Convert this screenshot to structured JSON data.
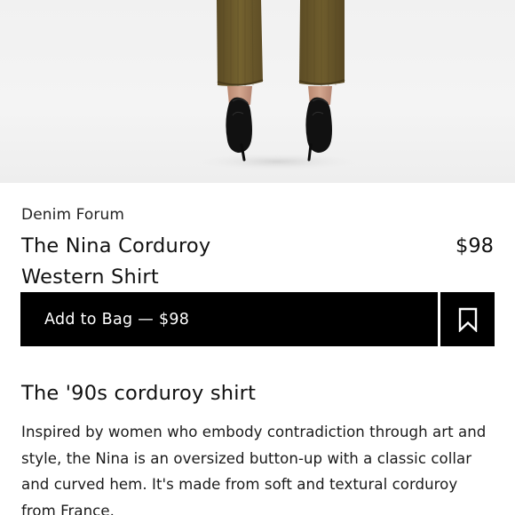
{
  "product": {
    "brand": "Denim Forum",
    "title": "The Nina Corduroy Western Shirt",
    "price": "$98"
  },
  "actions": {
    "add_to_bag_label": "Add to Bag — $98",
    "save_icon": "bookmark-icon"
  },
  "description": {
    "heading": "The '90s corduroy shirt",
    "body": "Inspired by women who embody contradiction through art and style, the Nina is an oversized button-up with a classic collar and curved hem. It's made from soft and textural corduroy from France."
  },
  "image": {
    "subject": "model-legs-corduroy-pants-black-heels",
    "colors": {
      "pants": "#6b5a2e",
      "heels": "#111111",
      "skin": "#c99a82",
      "background": "#f2f2f2"
    }
  },
  "theme": {
    "button_bg": "#000000",
    "button_text": "#ffffff"
  }
}
